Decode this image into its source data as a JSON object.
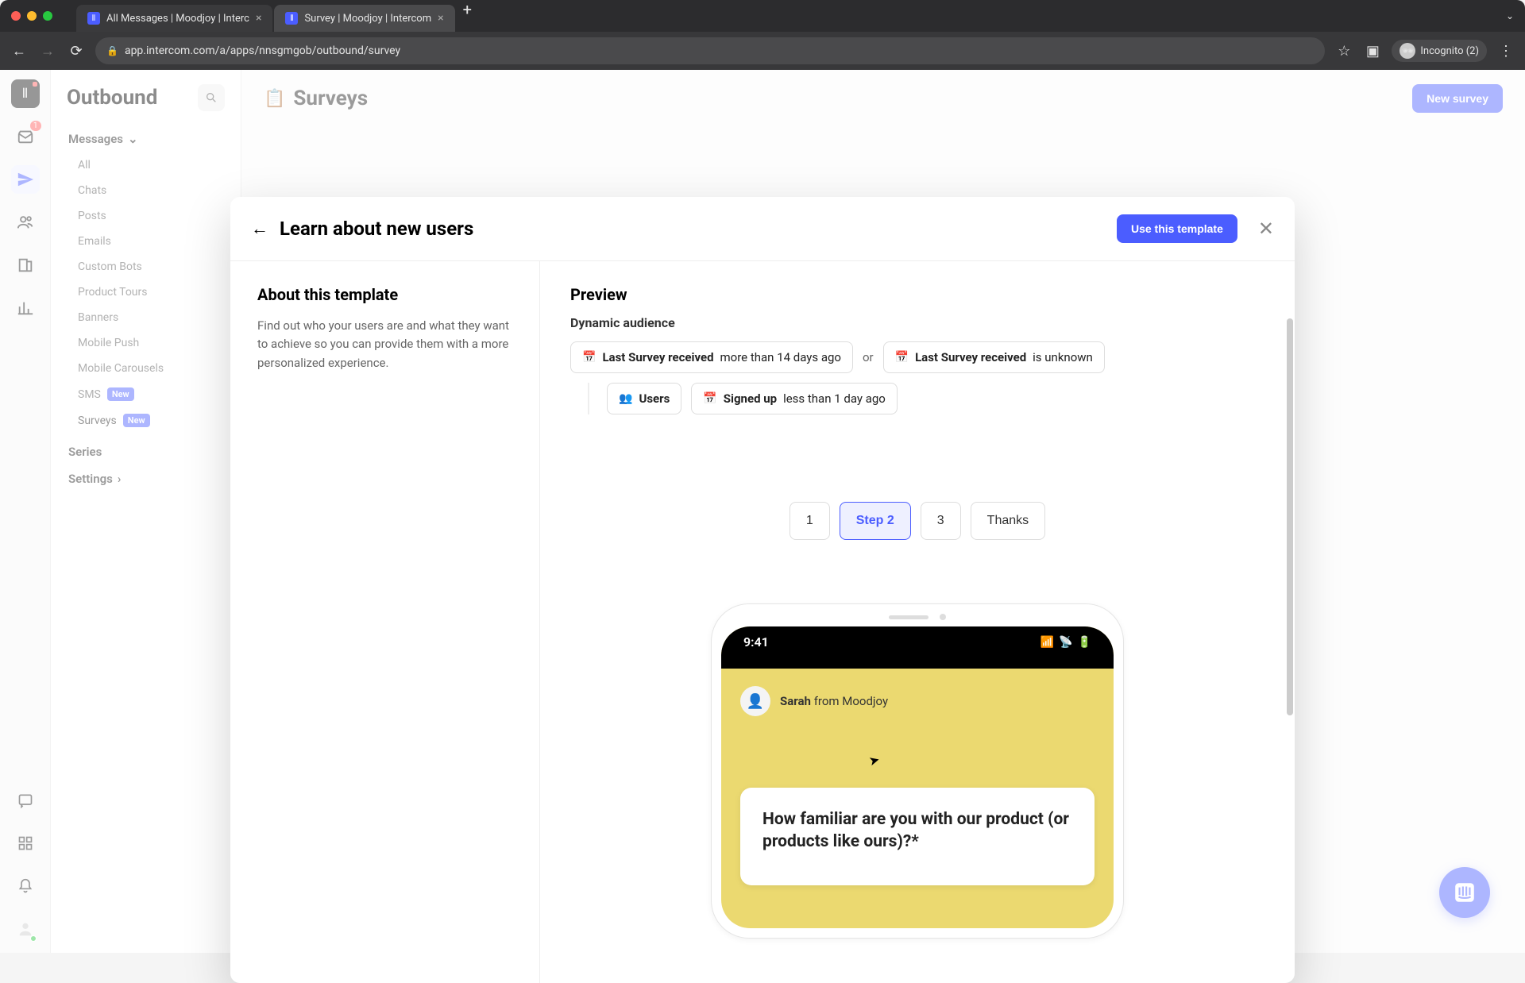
{
  "browser": {
    "tabs": [
      {
        "title": "All Messages | Moodjoy | Interc",
        "active": false
      },
      {
        "title": "Survey | Moodjoy | Intercom",
        "active": true
      }
    ],
    "url": "app.intercom.com/a/apps/nnsgmgob/outbound/survey",
    "incognito_label": "Incognito (2)"
  },
  "rail": {
    "inbox_badge": "1"
  },
  "sidebar": {
    "title": "Outbound",
    "group_messages": "Messages",
    "items": {
      "all": "All",
      "chats": "Chats",
      "posts": "Posts",
      "emails": "Emails",
      "custom_bots": "Custom Bots",
      "product_tours": "Product Tours",
      "banners": "Banners",
      "mobile_push": "Mobile Push",
      "mobile_carousels": "Mobile Carousels",
      "sms": "SMS",
      "surveys": "Surveys"
    },
    "new_badge": "New",
    "series": "Series",
    "settings": "Settings"
  },
  "main": {
    "title": "Surveys",
    "new_button": "New survey"
  },
  "modal": {
    "title": "Learn about new users",
    "use_button": "Use this template",
    "about_heading": "About this template",
    "about_body": "Find out who your users are and what they want to achieve so you can provide them with a more personalized experience.",
    "preview_heading": "Preview",
    "audience_title": "Dynamic audience",
    "chip1_label": "Last Survey received",
    "chip1_rest": "more than 14 days ago",
    "or": "or",
    "chip2_label": "Last Survey received",
    "chip2_rest": "is unknown",
    "chip3": "Users",
    "chip4_label": "Signed up",
    "chip4_rest": "less than 1 day ago",
    "steps": {
      "s1": "1",
      "s2": "Step 2",
      "s3": "3",
      "s4": "Thanks"
    },
    "phone": {
      "time": "9:41",
      "sender_name": "Sarah",
      "sender_rest": "from Moodjoy",
      "question": "How familiar are you with our product (or products like ours)?*"
    }
  }
}
